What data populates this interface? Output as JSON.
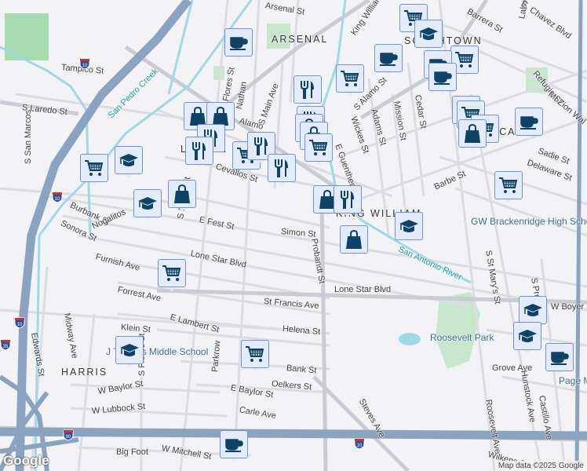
{
  "map": {
    "neighborhoods": [
      "ARSENAL",
      "SOUTHTOWN",
      "LAVACA",
      "KING WILLIAM",
      "HARRIS",
      "LAVACA"
    ],
    "streets": [
      "Tampico St",
      "S Laredo St",
      "S San Marcos",
      "Burbank St",
      "Sonora St",
      "Nogalitos",
      "Furnish Ave",
      "Forrest Ave",
      "Lone Star Blvd",
      "E Fest St",
      "Simon St",
      "Cevallos St",
      "S Flores St",
      "Flores St",
      "Nathan",
      "S Main Ave",
      "Arsenal St",
      "King William",
      "S Alamo St",
      "E Guenther St",
      "Wickes St",
      "Adams St",
      "Mission St",
      "Cedar St",
      "Barbe St",
      "Probandt St",
      "St Francis Ave",
      "Helena St",
      "Lone Star Blvd",
      "Klein St",
      "E Lambert St",
      "Bank St",
      "Oelkers St",
      "E Baylor St",
      "Carle Ave",
      "Parkrow",
      "W Baylor St",
      "W Lubbock St",
      "Big Foot",
      "W Mitchell St",
      "Midway Ave",
      "Edwards St",
      "Steves Ave",
      "Roosevelt Ave",
      "S St Mary's St",
      "S Presa St",
      "Grove Ave",
      "Hunstock Ave",
      "Castillo Ave",
      "Wilkens Ave",
      "W Boyer",
      "Refugio St",
      "Mt Zion Wal",
      "Sadie St",
      "Delaware St",
      "Labor St",
      "E. Chavez Blvd",
      "Barrera St",
      "Alamo",
      "S Flores St"
    ],
    "water_labels": [
      "San Pedro Creek",
      "San Antonio River"
    ],
    "poi_labels": [
      "GW Brackenridge High School",
      "Roosevelt Park",
      "J T Harris Middle School",
      "Page Middle"
    ],
    "highway_shields": [
      "10",
      "10",
      "10",
      "10",
      "35",
      "90"
    ],
    "markers": [
      "coffee",
      "grocery",
      "restaurant",
      "grocery",
      "school",
      "coffee",
      "grocery",
      "coffee",
      "coffee",
      "grocery",
      "grocery",
      "grocery",
      "shopping",
      "coffee",
      "grocery",
      "shopping",
      "shopping",
      "restaurant",
      "restaurant",
      "grocery",
      "restaurant",
      "restaurant",
      "restaurant",
      "shopping",
      "shopping",
      "grocery",
      "grocery",
      "school",
      "school",
      "shopping",
      "shopping",
      "restaurant",
      "school",
      "shopping",
      "grocery",
      "grocery",
      "school",
      "school",
      "school",
      "coffee",
      "coffee"
    ],
    "attribution": "Map data ©2025 Google",
    "logo": "Google",
    "colors": {
      "marker_fill": "#e4ecfb",
      "marker_border": "#6f93d8",
      "icon": "#0e4266",
      "highway": "#8aa3c0",
      "water": "#9fd9e8",
      "park": "#bfe3c4"
    }
  }
}
